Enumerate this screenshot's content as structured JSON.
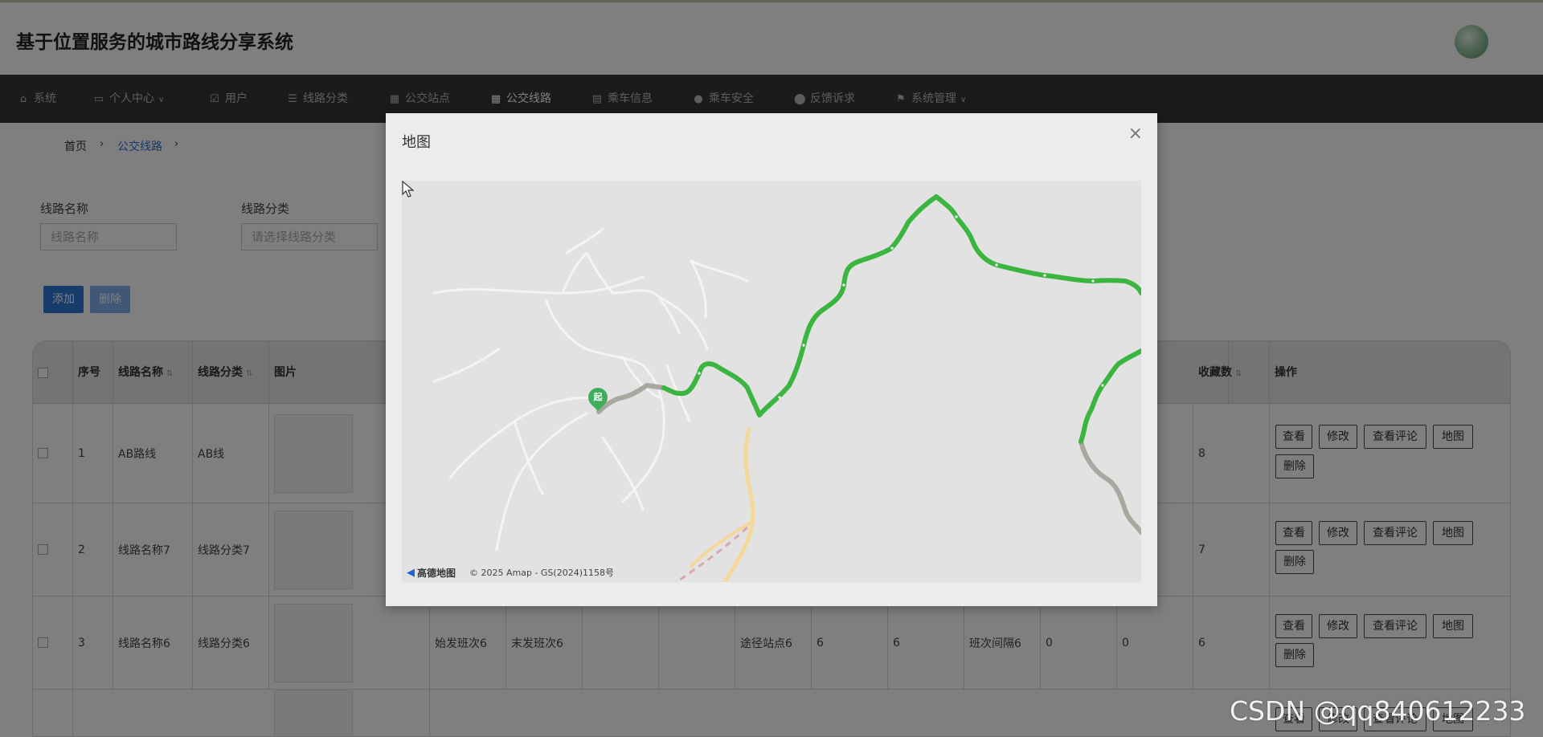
{
  "header": {
    "title": "基于位置服务的城市路线分享系统"
  },
  "nav": {
    "items": [
      {
        "label": "系统",
        "icon": "home-icon"
      },
      {
        "label": "个人中心",
        "icon": "id-card-icon",
        "dropdown": true
      },
      {
        "label": "用户",
        "icon": "checkbox-icon"
      },
      {
        "label": "线路分类",
        "icon": "sliders-icon"
      },
      {
        "label": "公交站点",
        "icon": "grid-icon"
      },
      {
        "label": "公交线路",
        "icon": "grid-icon",
        "active": true
      },
      {
        "label": "乘车信息",
        "icon": "table-icon"
      },
      {
        "label": "乘车安全",
        "icon": "user-icon"
      },
      {
        "label": "反馈诉求",
        "icon": "map-pin-icon"
      },
      {
        "label": "系统管理",
        "icon": "flag-icon",
        "dropdown": true
      }
    ]
  },
  "breadcrumb": {
    "home": "首页",
    "current": "公交线路"
  },
  "filters": {
    "route_name": {
      "label": "线路名称",
      "placeholder": "线路名称"
    },
    "route_category": {
      "label": "线路分类",
      "placeholder": "请选择线路分类"
    }
  },
  "actions": {
    "add": "添加",
    "delete": "删除"
  },
  "table": {
    "headers": {
      "index": "序号",
      "route_name": "线路名称",
      "route_category": "线路分类",
      "image": "图片",
      "favorites": "收藏数",
      "operations": "操作"
    },
    "rows": [
      {
        "index": "1",
        "route_name": "AB路线",
        "route_category": "AB线",
        "favorites": "8"
      },
      {
        "index": "2",
        "route_name": "线路名称7",
        "route_category": "线路分类7",
        "favorites": "7"
      },
      {
        "index": "3",
        "route_name": "线路名称6",
        "route_category": "线路分类6",
        "first_bus": "始发班次6",
        "last_bus": "末发班次6",
        "stops": "途径站点6",
        "c1": "6",
        "c2": "6",
        "interval": "班次间隔6",
        "c3": "0",
        "c4": "0",
        "favorites": "6"
      }
    ],
    "row_buttons": {
      "view": "查看",
      "edit": "修改",
      "comments": "查看评论",
      "map": "地图",
      "delete": "删除"
    }
  },
  "modal": {
    "title": "地图",
    "close": "×",
    "map": {
      "start_marker": "起",
      "logo": "高德地图",
      "copyright": "© 2025 Amap - GS(2024)1158号"
    }
  },
  "watermark": "CSDN @qq840612233",
  "colors": {
    "route": "#3ab53f",
    "nav_bg": "#373737",
    "primary": "#2f77d6"
  }
}
